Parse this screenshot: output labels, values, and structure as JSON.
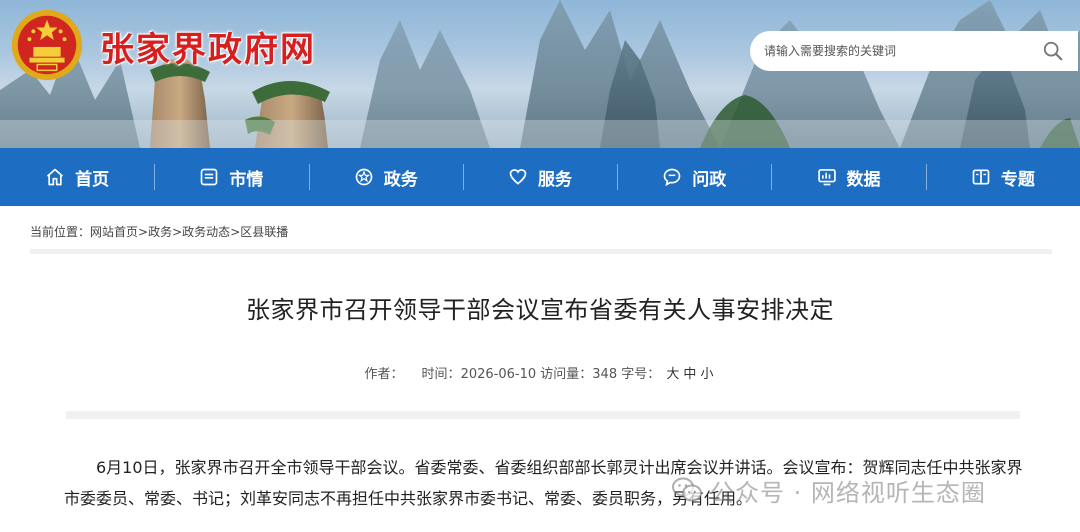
{
  "header": {
    "site_title": "张家界政府网",
    "search_placeholder": "请输入需要搜索的关键词"
  },
  "nav": [
    {
      "label": "首页",
      "icon": "home-icon"
    },
    {
      "label": "市情",
      "icon": "document-icon"
    },
    {
      "label": "政务",
      "icon": "emblem-icon"
    },
    {
      "label": "服务",
      "icon": "heart-icon"
    },
    {
      "label": "问政",
      "icon": "chat-icon"
    },
    {
      "label": "数据",
      "icon": "chart-icon"
    },
    {
      "label": "专题",
      "icon": "book-icon"
    }
  ],
  "breadcrumb": {
    "prefix": "当前位置：",
    "items": [
      "网站首页",
      "政务",
      "政务动态",
      "区县联播"
    ],
    "separator": ">"
  },
  "article": {
    "title": "张家界市召开领导干部会议宣布省委有关人事安排决定",
    "meta": {
      "author_label": "作者：",
      "time_label": "时间：",
      "time_value": "2026-06-10",
      "visits_label": "访问量：",
      "visits_value": "348",
      "font_label": "字号：",
      "font_sizes": [
        "大",
        "中",
        "小"
      ]
    },
    "body": "6月10日，张家界市召开全市领导干部会议。省委常委、省委组织部部长郭灵计出席会议并讲话。会议宣布：贺辉同志任中共张家界市委委员、常委、书记；刘革安同志不再担任中共张家界市委书记、常委、委员职务，另有任用。"
  },
  "watermark": {
    "text": "公众号 · 网络视听生态圈"
  },
  "colors": {
    "nav_bg": "#1d6ec3",
    "title_red": "#d71f1f"
  }
}
